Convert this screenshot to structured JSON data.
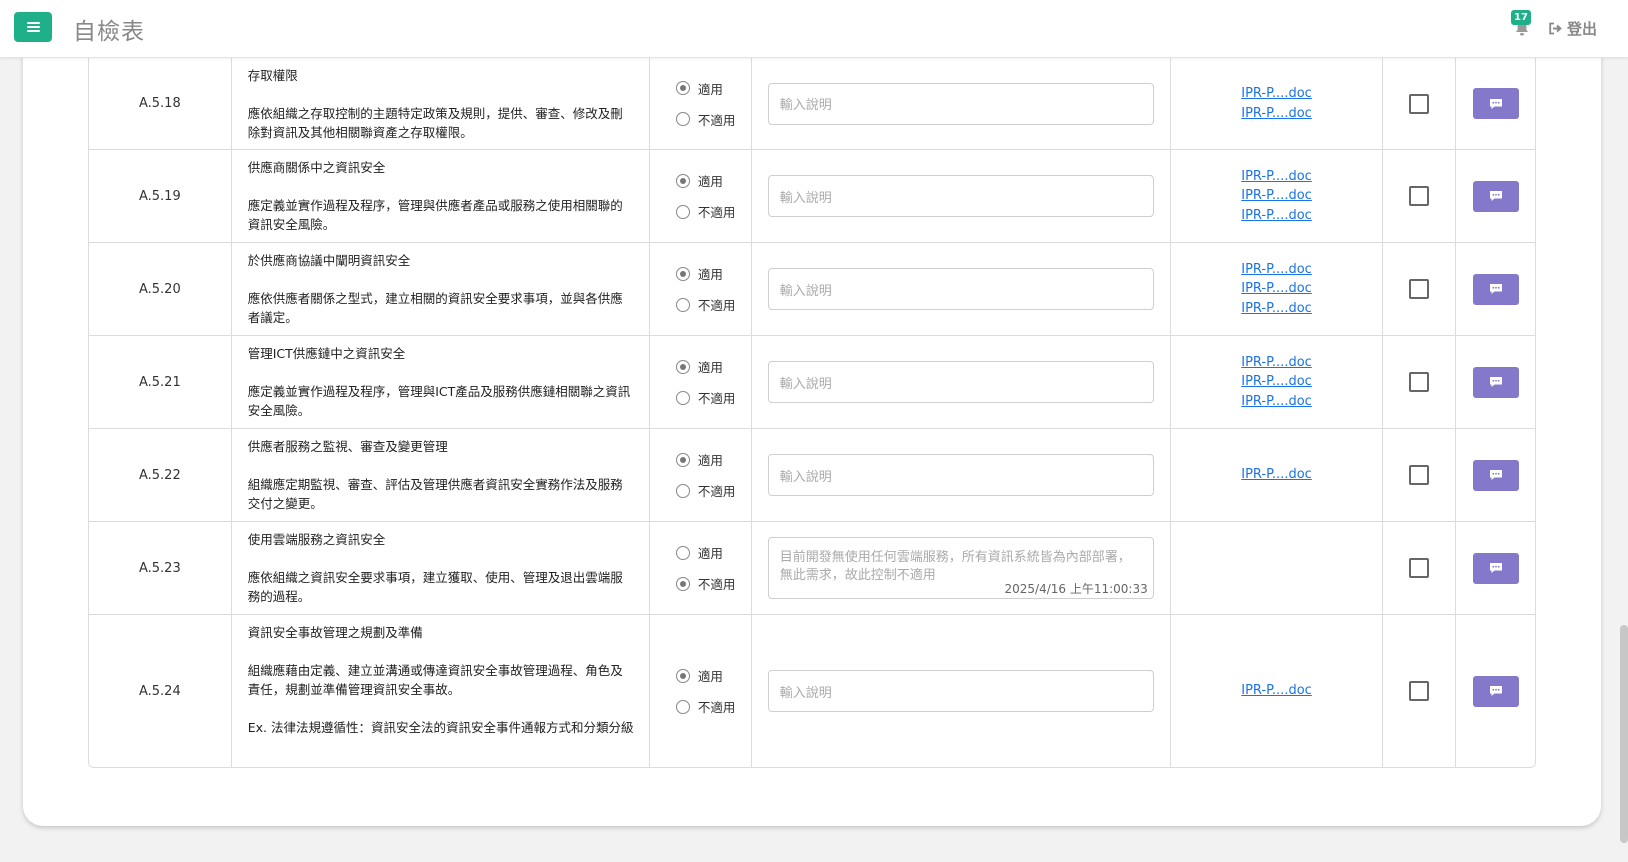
{
  "header": {
    "page_title": "自檢表",
    "notification_count": "17",
    "logout_label": "登出"
  },
  "colors": {
    "accent": "#1fb08a",
    "comment_button": "#8378c9",
    "link": "#1a73e8"
  },
  "icons": [
    "hamburger-menu-icon",
    "bell-icon",
    "sign-out-icon",
    "comment-icon"
  ],
  "rows": [
    {
      "code": "A.5.18",
      "title": "存取權限",
      "body": "應依組織之存取控制的主題特定政策及規則，提供、審查、修改及刪除對資訊及其他相關聯資產之存取權限。",
      "extra": "",
      "options": [
        "適用",
        "不適用"
      ],
      "selected": "適用",
      "note_placeholder": "輸入說明",
      "note_value": "",
      "note_time": "",
      "files": [
        "IPR-P....doc",
        "IPR-P....doc"
      ],
      "checked": false
    },
    {
      "code": "A.5.19",
      "title": "供應商關係中之資訊安全",
      "body": "應定義並實作過程及程序，管理與供應者產品或服務之使用相關聯的資訊安全風險。",
      "extra": "",
      "options": [
        "適用",
        "不適用"
      ],
      "selected": "適用",
      "note_placeholder": "輸入說明",
      "note_value": "",
      "note_time": "",
      "files": [
        "IPR-P....doc",
        "IPR-P....doc",
        "IPR-P....doc"
      ],
      "checked": false
    },
    {
      "code": "A.5.20",
      "title": "於供應商協議中闡明資訊安全",
      "body": "應依供應者關係之型式，建立相關的資訊安全要求事項，並與各供應者議定。",
      "extra": "",
      "options": [
        "適用",
        "不適用"
      ],
      "selected": "適用",
      "note_placeholder": "輸入說明",
      "note_value": "",
      "note_time": "",
      "files": [
        "IPR-P....doc",
        "IPR-P....doc",
        "IPR-P....doc"
      ],
      "checked": false
    },
    {
      "code": "A.5.21",
      "title": "管理ICT供應鏈中之資訊安全",
      "body": "應定義並實作過程及程序，管理與ICT產品及服務供應鏈相關聯之資訊安全風險。",
      "extra": "",
      "options": [
        "適用",
        "不適用"
      ],
      "selected": "適用",
      "note_placeholder": "輸入說明",
      "note_value": "",
      "note_time": "",
      "files": [
        "IPR-P....doc",
        "IPR-P....doc",
        "IPR-P....doc"
      ],
      "checked": false
    },
    {
      "code": "A.5.22",
      "title": "供應者服務之監視、審查及變更管理",
      "body": "組織應定期監視、審查、評估及管理供應者資訊安全實務作法及服務交付之變更。",
      "extra": "",
      "options": [
        "適用",
        "不適用"
      ],
      "selected": "適用",
      "note_placeholder": "輸入說明",
      "note_value": "",
      "note_time": "",
      "files": [
        "IPR-P....doc"
      ],
      "checked": false
    },
    {
      "code": "A.5.23",
      "title": "使用雲端服務之資訊安全",
      "body": "應依組織之資訊安全要求事項，建立獲取、使用、管理及退出雲端服務的過程。",
      "extra": "",
      "options": [
        "適用",
        "不適用"
      ],
      "selected": "不適用",
      "note_placeholder": "輸入說明",
      "note_value": "目前開發無使用任何雲端服務，所有資訊系統皆為內部部署，無此需求，故此控制不適用",
      "note_time": "2025/4/16 上午11:00:33",
      "files": [],
      "checked": false
    },
    {
      "code": "A.5.24",
      "title": "資訊安全事故管理之規劃及準備",
      "body": "組織應藉由定義、建立並溝通或傳達資訊安全事故管理過程、角色及責任，規劃並準備管理資訊安全事故。",
      "extra": "Ex. 法律法規遵循性：資訊安全法的資訊安全事件通報方式和分類分級",
      "options": [
        "適用",
        "不適用"
      ],
      "selected": "適用",
      "note_placeholder": "輸入說明",
      "note_value": "",
      "note_time": "",
      "files": [
        "IPR-P....doc"
      ],
      "checked": false
    }
  ]
}
